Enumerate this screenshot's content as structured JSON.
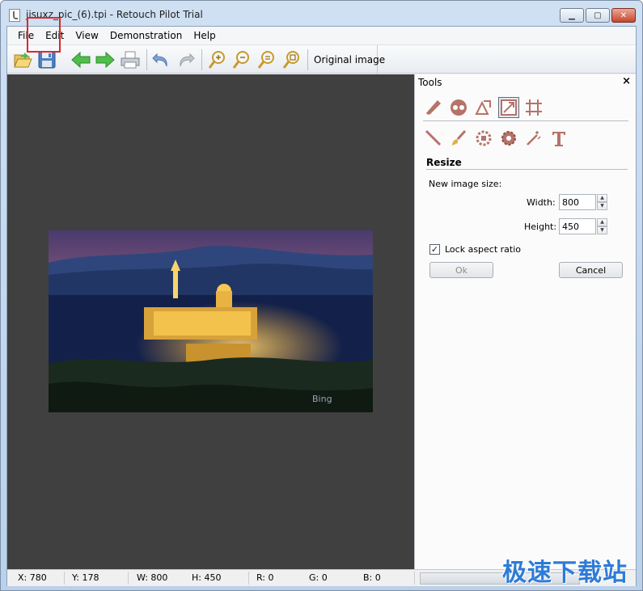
{
  "window": {
    "title": "jisuxz_pic_(6).tpi - Retouch Pilot Trial",
    "controls": {
      "minimize": "▁",
      "maximize": "▢",
      "close": "✕"
    }
  },
  "menu": [
    "File",
    "Edit",
    "View",
    "Demonstration",
    "Help"
  ],
  "toolbar": {
    "buttons": [
      "open-folder-icon",
      "save-disk-icon",
      "back-arrow-icon",
      "forward-arrow-icon",
      "print-icon",
      "undo-icon",
      "redo-icon",
      "zoom-in-icon",
      "zoom-out-icon",
      "zoom-fit-icon",
      "zoom-actual-icon"
    ],
    "original_image_label": "Original image"
  },
  "canvas": {
    "background": "#404040",
    "image_watermark": "Bing"
  },
  "tools_panel": {
    "title": "Tools",
    "close": "×",
    "section_title": "Resize",
    "new_size_label": "New image size:",
    "width_label": "Width:",
    "width_value": "800",
    "height_label": "Height:",
    "height_value": "450",
    "lock_aspect_label": "Lock aspect ratio",
    "lock_aspect_checked": true,
    "ok_label": "Ok",
    "cancel_label": "Cancel"
  },
  "status": {
    "x": "X: 780",
    "y": "Y: 178",
    "w": "W: 800",
    "h": "H: 450",
    "r": "R: 0",
    "g": "G: 0",
    "b": "B: 0"
  },
  "site_watermark": "极速下载站",
  "colors": {
    "highlight_box": "#e0262a",
    "tool_icon": "#b5736a",
    "watermark": "#2e7bd6"
  }
}
